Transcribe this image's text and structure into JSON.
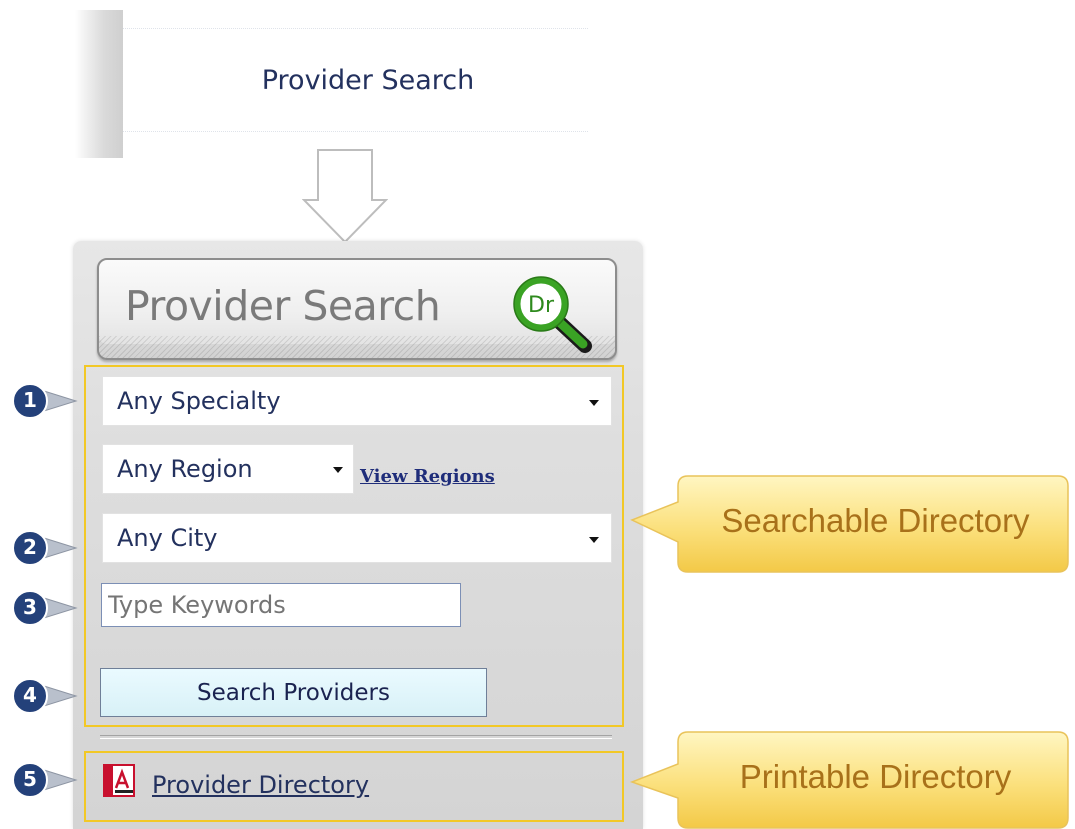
{
  "top_menu": {
    "item_label": "Provider Search"
  },
  "widget": {
    "header_title": "Provider Search",
    "header_icon_text": "Dr",
    "specialty_select": {
      "value": "Any Specialty"
    },
    "region_select": {
      "value": "Any Region"
    },
    "view_regions_link": "View Regions",
    "city_select": {
      "value": "Any City"
    },
    "keywords_input": {
      "placeholder": "Type Keywords"
    },
    "search_button_label": "Search Providers",
    "provider_directory_link": "Provider Directory"
  },
  "markers": [
    "1",
    "2",
    "3",
    "4",
    "5"
  ],
  "callouts": {
    "searchable": "Searchable Directory",
    "printable": "Printable Directory"
  },
  "colors": {
    "navy_text": "#23315e",
    "link_blue": "#1f2d7a",
    "highlight_yellow": "#f2c826",
    "callout_text": "#a8711a",
    "marker_fill": "#24417a",
    "magnifier_green": "#3aa324"
  },
  "icons": [
    "down-arrow-icon",
    "dr-magnifier-icon",
    "chevron-down-icon",
    "pdf-icon"
  ]
}
